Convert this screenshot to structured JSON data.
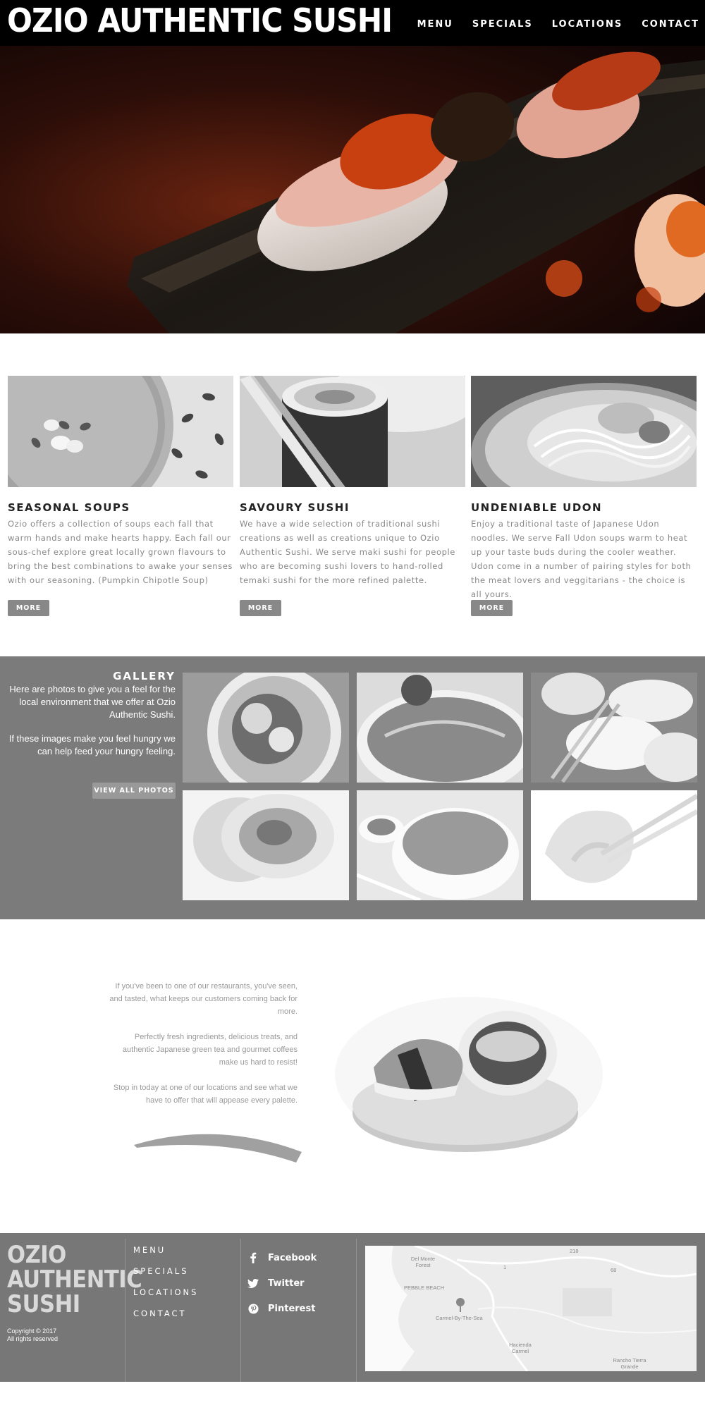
{
  "header": {
    "logo": "OZIO AUTHENTIC SUSHI",
    "nav": [
      "MENU",
      "SPECIALS",
      "LOCATIONS",
      "CONTACT"
    ]
  },
  "features": [
    {
      "title": "SEASONAL SOUPS",
      "text": "Ozio offers a collection of soups each fall that warm hands and make hearts happy. Each fall our sous-chef explore great locally grown flavours to bring the best combinations to awake your senses with our seasoning. (Pumpkin Chipotle Soup)",
      "button": "MORE"
    },
    {
      "title": "SAVOURY SUSHI",
      "text": "We have a wide selection of traditional sushi creations as well as creations unique to Ozio Authentic Sushi. We serve maki sushi for people who are becoming sushi lovers to hand-rolled temaki sushi for the more refined palette.",
      "button": "MORE"
    },
    {
      "title": "UNDENIABLE UDON",
      "text": "Enjoy a traditional taste of Japanese Udon noodles. We serve Fall Udon soups warm to heat up your taste buds during the cooler weather. Udon come in a number of pairing styles for both the meat lovers and veggitarians - the choice is all yours.",
      "button": "MORE"
    }
  ],
  "gallery": {
    "title": "GALLERY",
    "text1": "Here are photos to give you a feel for the local environment that we offer at Ozio Authentic Sushi.",
    "text2": "If these images make you feel hungry we can help feed your hungry feeling.",
    "button": "VIEW ALL PHOTOS"
  },
  "about": {
    "p1": "If you've been to one of our restaurants, you've seen, and tasted, what keeps our customers coming back for more.",
    "p2": "Perfectly fresh ingredients, delicious treats, and authentic Japanese green tea and gourmet coffees make us hard to resist!",
    "p3": "Stop in today at one of our locations and see  what we have to offer that will appease every palette."
  },
  "footer": {
    "logo_lines": [
      "OZIO",
      "AUTHENTIC",
      "SUSHI"
    ],
    "copyright": "Copyright © 2017",
    "rights": "All rights reserved",
    "nav": [
      "MENU",
      "SPECIALS",
      "LOCATIONS",
      "CONTACT"
    ],
    "social": [
      {
        "label": "Facebook",
        "icon": "facebook-icon"
      },
      {
        "label": "Twitter",
        "icon": "twitter-icon"
      },
      {
        "label": "Pinterest",
        "icon": "pinterest-icon"
      }
    ],
    "map_labels": {
      "del_monte": "Del Monte Forest",
      "pebble": "PEBBLE BEACH",
      "carmel_sea": "Carmel-By-The-Sea",
      "hacienda": "Hacienda Carmel",
      "rancho": "Rancho Tierra Grande",
      "r1": "1",
      "r68": "68",
      "r218": "218"
    }
  }
}
